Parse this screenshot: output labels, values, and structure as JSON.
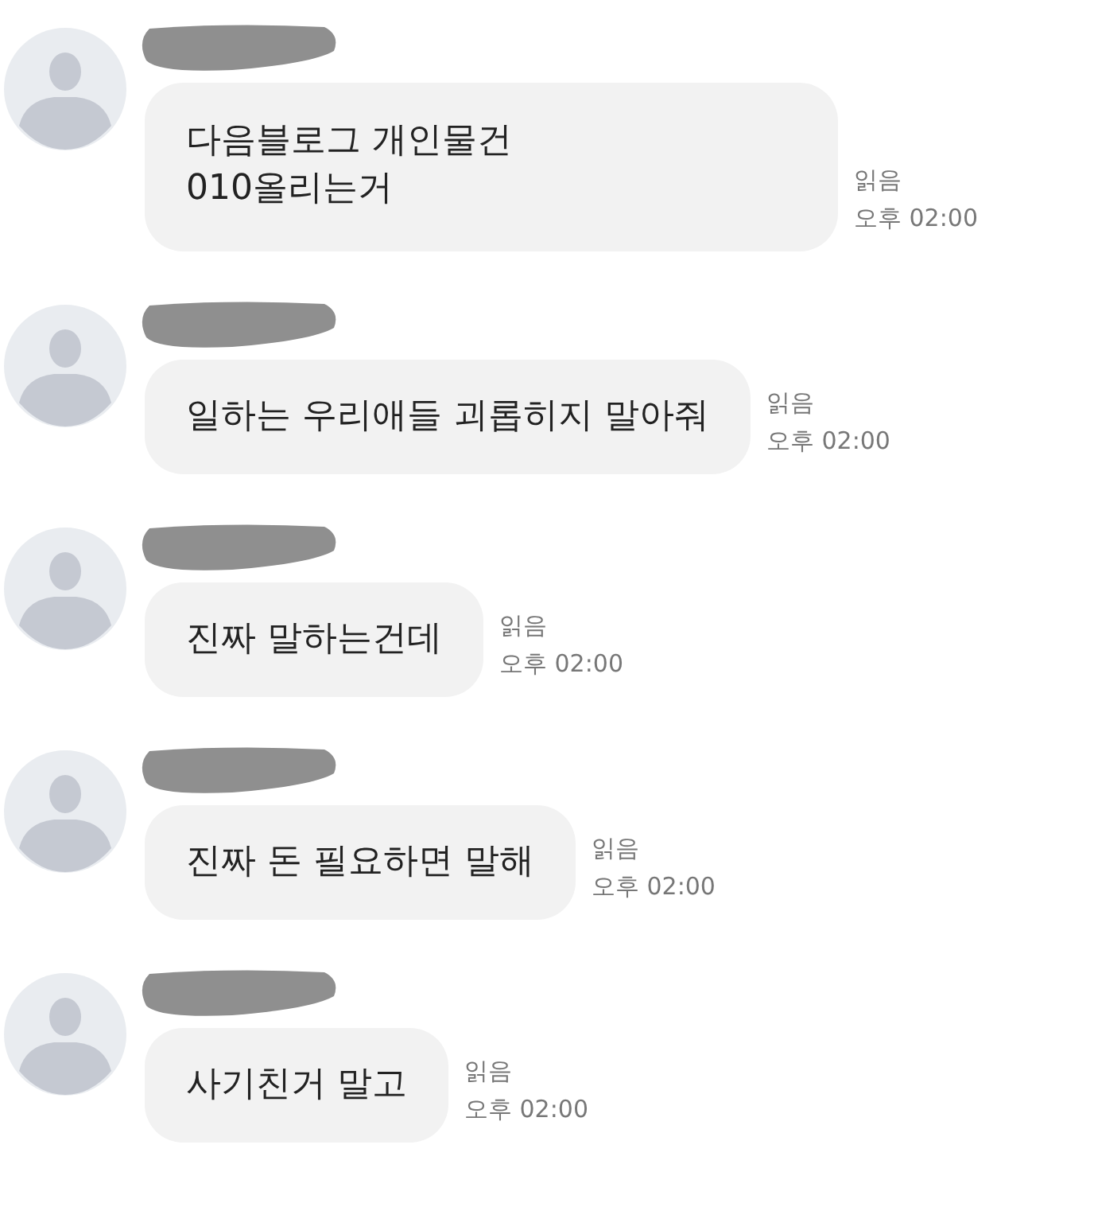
{
  "messages": [
    {
      "name_redacted": true,
      "text": "다음블로그  개인물건\n010올리는거",
      "read_label": "읽음",
      "time": "오후 02:00"
    },
    {
      "name_redacted": true,
      "text": "일하는 우리애들 괴롭히지 말아줘",
      "read_label": "읽음",
      "time": "오후 02:00"
    },
    {
      "name_redacted": true,
      "text": "진짜 말하는건데",
      "read_label": "읽음",
      "time": "오후 02:00"
    },
    {
      "name_redacted": true,
      "text": "진짜 돈 필요하면 말해",
      "read_label": "읽음",
      "time": "오후 02:00"
    },
    {
      "name_redacted": true,
      "text": "사기친거 말고",
      "read_label": "읽음",
      "time": "오후 02:00"
    }
  ]
}
